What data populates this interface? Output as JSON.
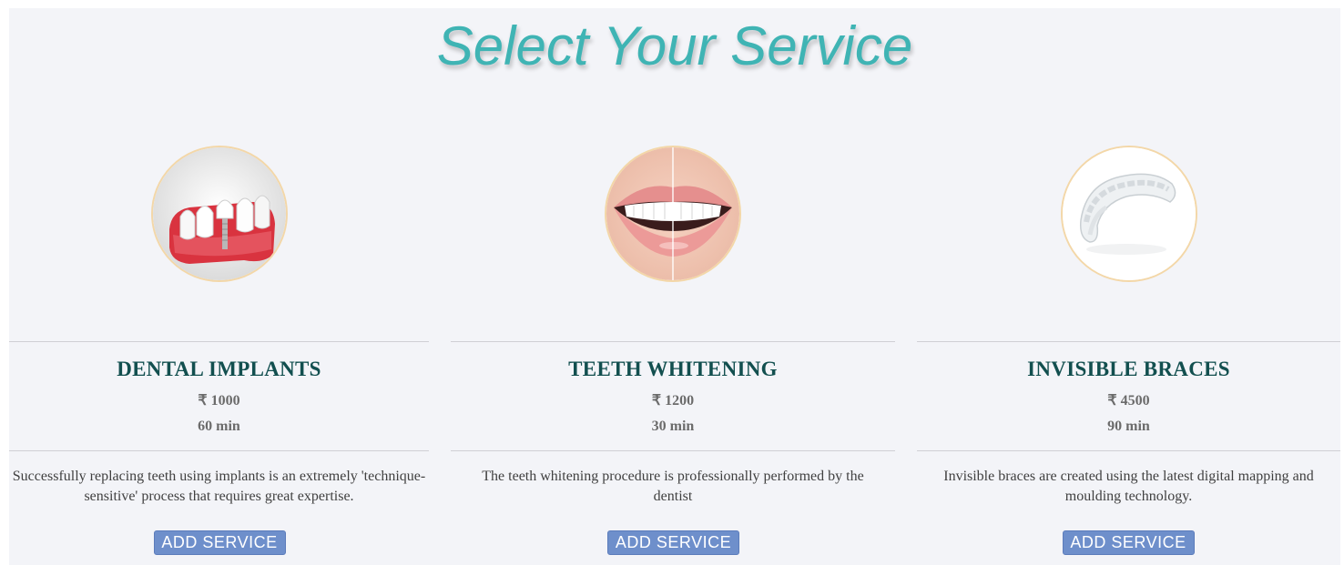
{
  "header": {
    "title": "Select Your Service"
  },
  "services": [
    {
      "name": "DENTAL IMPLANTS",
      "price": "₹ 1000",
      "duration": "60 min",
      "description": "Successfully replacing teeth using implants is an extremely 'technique-sensitive' process that requires great expertise.",
      "button_label": "ADD SERVICE",
      "image_icon": "dental-implant-image"
    },
    {
      "name": "TEETH WHITENING",
      "price": "₹ 1200",
      "duration": "30 min",
      "description": "The teeth whitening procedure is professionally performed by the dentist",
      "button_label": "ADD SERVICE",
      "image_icon": "smile-lips-image"
    },
    {
      "name": "INVISIBLE BRACES",
      "price": "₹ 4500",
      "duration": "90 min",
      "description": "Invisible braces are created using the latest digital mapping and moulding technology.",
      "button_label": "ADD SERVICE",
      "image_icon": "clear-aligner-image"
    }
  ],
  "colors": {
    "title": "#3fb4b4",
    "service_name": "#124f4f",
    "button": "#6e8fcb",
    "image_ring": "#f3d7a8",
    "background": "#f3f4f8"
  }
}
